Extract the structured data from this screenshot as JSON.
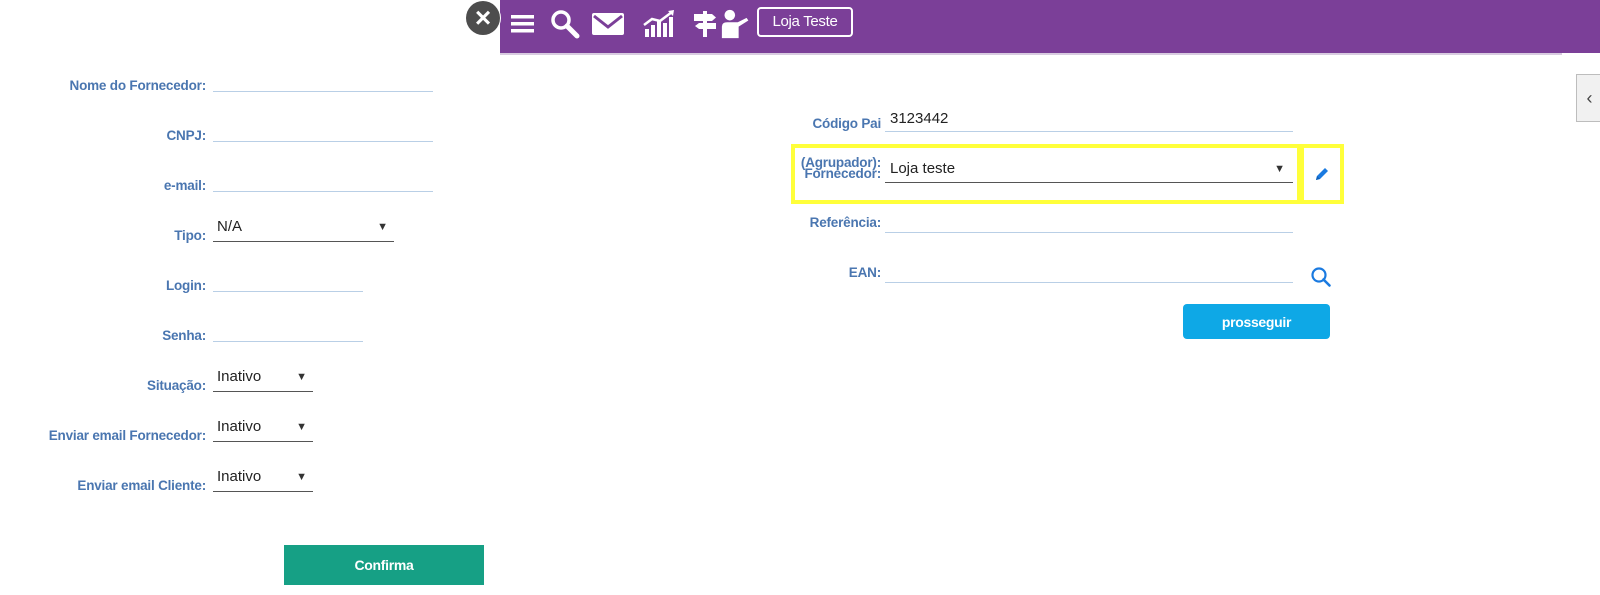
{
  "supplier_form": {
    "fields": [
      {
        "label": "Nome do Fornecedor:",
        "value": ""
      },
      {
        "label": "CNPJ:",
        "value": ""
      },
      {
        "label": "e-mail:",
        "value": ""
      },
      {
        "label": "Tipo:",
        "selected": "N/A"
      },
      {
        "label": "Login:",
        "value": ""
      },
      {
        "label": "Senha:",
        "value": ""
      },
      {
        "label": "Situação:",
        "selected": "Inativo"
      },
      {
        "label": "Enviar email Fornecedor:",
        "selected": "Inativo"
      },
      {
        "label": "Enviar email Cliente:",
        "selected": "Inativo"
      }
    ],
    "confirm_label": "Confirma"
  },
  "topbar": {
    "color": "#7b3f98",
    "icons": [
      "menu-icon",
      "search-icon",
      "mail-icon",
      "chart-icon",
      "signpost-icon",
      "user-presenter-icon"
    ],
    "store_label": "Loja Teste"
  },
  "product_form": {
    "codigo_pai": {
      "label": "Código Pai",
      "value": "3123442"
    },
    "agrupador": {
      "label_line1": "(Agrupador):",
      "label_line2": "Fornecedor:",
      "selected": "Loja teste"
    },
    "referencia": {
      "label": "Referência:",
      "value": ""
    },
    "ean": {
      "label": "EAN:",
      "value": ""
    },
    "proceed_label": "prosseguir"
  },
  "colors": {
    "label_blue": "#4a76b0",
    "confirm_green": "#16a085",
    "proceed_blue": "#0ea8e6",
    "highlight_yellow": "#ffff3a"
  }
}
